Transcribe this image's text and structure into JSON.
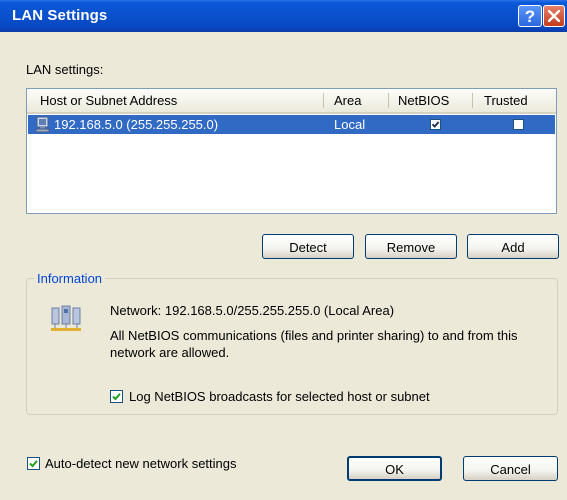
{
  "window": {
    "title": "LAN Settings",
    "help_label": "?",
    "colors": {
      "titlebar": "#0a50cc",
      "selection": "#316ac5",
      "group_title": "#0046d5",
      "face": "#ece9d8"
    }
  },
  "lan_settings_label": "LAN settings:",
  "list": {
    "columns": [
      "Host or Subnet Address",
      "Area",
      "NetBIOS",
      "Trusted"
    ],
    "rows": [
      {
        "address": "192.168.5.0 (255.255.255.0)",
        "area": "Local",
        "netbios": true,
        "trusted": false
      }
    ]
  },
  "buttons": {
    "detect": "Detect",
    "remove": "Remove",
    "add": "Add",
    "ok": "OK",
    "cancel": "Cancel"
  },
  "information": {
    "title": "Information",
    "icon": "network-computers-icon",
    "network_line": "Network: 192.168.5.0/255.255.255.0 (Local Area)",
    "netbios_line1": "All NetBIOS communications (files and printer sharing) to and from this",
    "netbios_line2": "network are allowed.",
    "log_label": "Log NetBIOS broadcasts for selected host or subnet",
    "log_checked": true
  },
  "auto_detect": {
    "label": "Auto-detect new network settings",
    "checked": true
  }
}
